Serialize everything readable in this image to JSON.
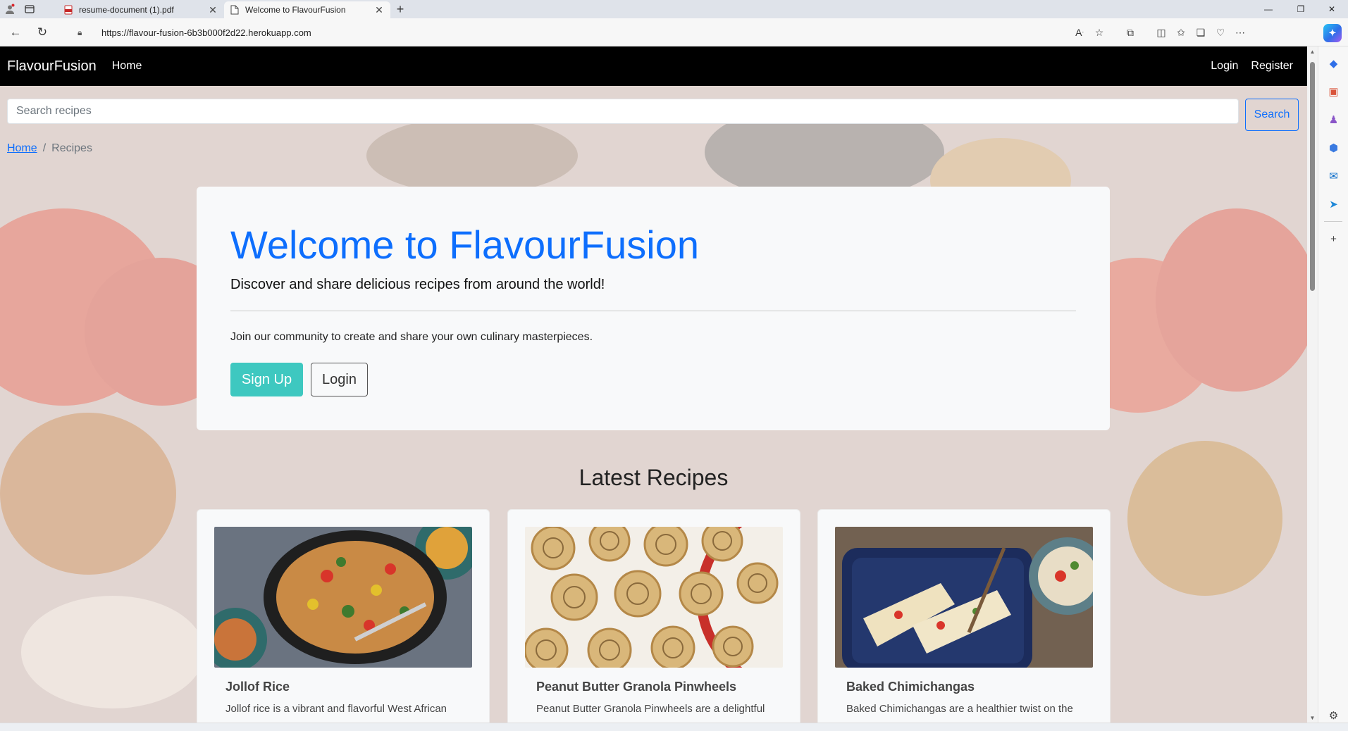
{
  "browser": {
    "tabs": [
      {
        "title": "resume-document (1).pdf",
        "icon": "pdf-icon",
        "active": false
      },
      {
        "title": "Welcome to FlavourFusion",
        "icon": "page-icon",
        "active": true
      }
    ],
    "url": "https://flavour-fusion-6b3b000f2d22.herokuapp.com"
  },
  "navbar": {
    "brand": "FlavourFusion",
    "home": "Home",
    "login": "Login",
    "register": "Register"
  },
  "search": {
    "placeholder": "Search recipes",
    "button": "Search"
  },
  "breadcrumb": {
    "home": "Home",
    "separator": "/",
    "current": "Recipes"
  },
  "hero": {
    "title": "Welcome to FlavourFusion",
    "lead": "Discover and share delicious recipes from around the world!",
    "text": "Join our community to create and share your own culinary masterpieces.",
    "signup": "Sign Up",
    "login": "Login"
  },
  "latest": {
    "title": "Latest Recipes",
    "cards": [
      {
        "title": "Jollof Rice",
        "desc": "Jollof rice is a vibrant and flavorful West African"
      },
      {
        "title": "Peanut Butter Granola Pinwheels",
        "desc": "Peanut Butter Granola Pinwheels are a delightful"
      },
      {
        "title": "Baked Chimichangas",
        "desc": "Baked Chimichangas are a healthier twist on the"
      }
    ]
  },
  "colors": {
    "accent": "#0d6efd",
    "signup": "#3ec8c0",
    "navbar": "#000000"
  }
}
